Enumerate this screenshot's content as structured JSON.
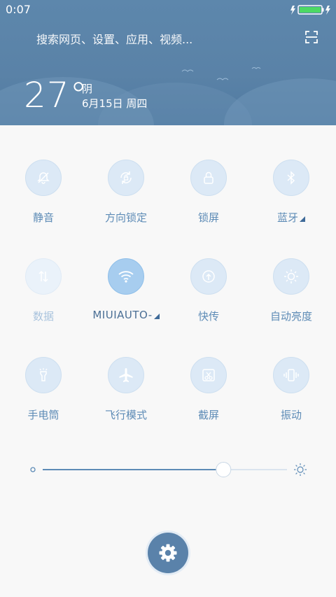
{
  "status_bar": {
    "time": "0:07",
    "battery_color": "#4cd964"
  },
  "header": {
    "search_placeholder": "搜索网页、设置、应用、视频...",
    "temperature": "27°",
    "weather": "阴",
    "date": "6月15日 周四",
    "scan_icon": "scan-icon",
    "background_color": "#5a82a7"
  },
  "toggles": [
    {
      "label": "静音",
      "icon": "silent-icon",
      "state": "off"
    },
    {
      "label": "方向锁定",
      "icon": "rotation-lock-icon",
      "state": "off"
    },
    {
      "label": "锁屏",
      "icon": "lock-icon",
      "state": "off"
    },
    {
      "label": "蓝牙",
      "icon": "bluetooth-icon",
      "state": "off",
      "has_expand": true
    },
    {
      "label": "数据",
      "icon": "mobile-data-icon",
      "state": "disabled"
    },
    {
      "label": "MIUIAUTO-",
      "icon": "wifi-icon",
      "state": "on",
      "has_expand": true
    },
    {
      "label": "快传",
      "icon": "mi-drop-icon",
      "state": "off"
    },
    {
      "label": "自动亮度",
      "icon": "auto-brightness-icon",
      "state": "off"
    },
    {
      "label": "手电筒",
      "icon": "flashlight-icon",
      "state": "off"
    },
    {
      "label": "飞行模式",
      "icon": "airplane-icon",
      "state": "off"
    },
    {
      "label": "截屏",
      "icon": "screenshot-icon",
      "state": "off"
    },
    {
      "label": "振动",
      "icon": "vibrate-icon",
      "state": "off"
    }
  ],
  "brightness": {
    "level": 0.74,
    "low_icon": "brightness-low-icon",
    "high_icon": "brightness-high-icon"
  },
  "settings_button": {
    "icon": "gear-icon",
    "color": "#5a82aa"
  },
  "colors": {
    "accent": "#5d8bb6",
    "toggle_bg": "#dce9f6",
    "toggle_on": "#a7cdef"
  }
}
